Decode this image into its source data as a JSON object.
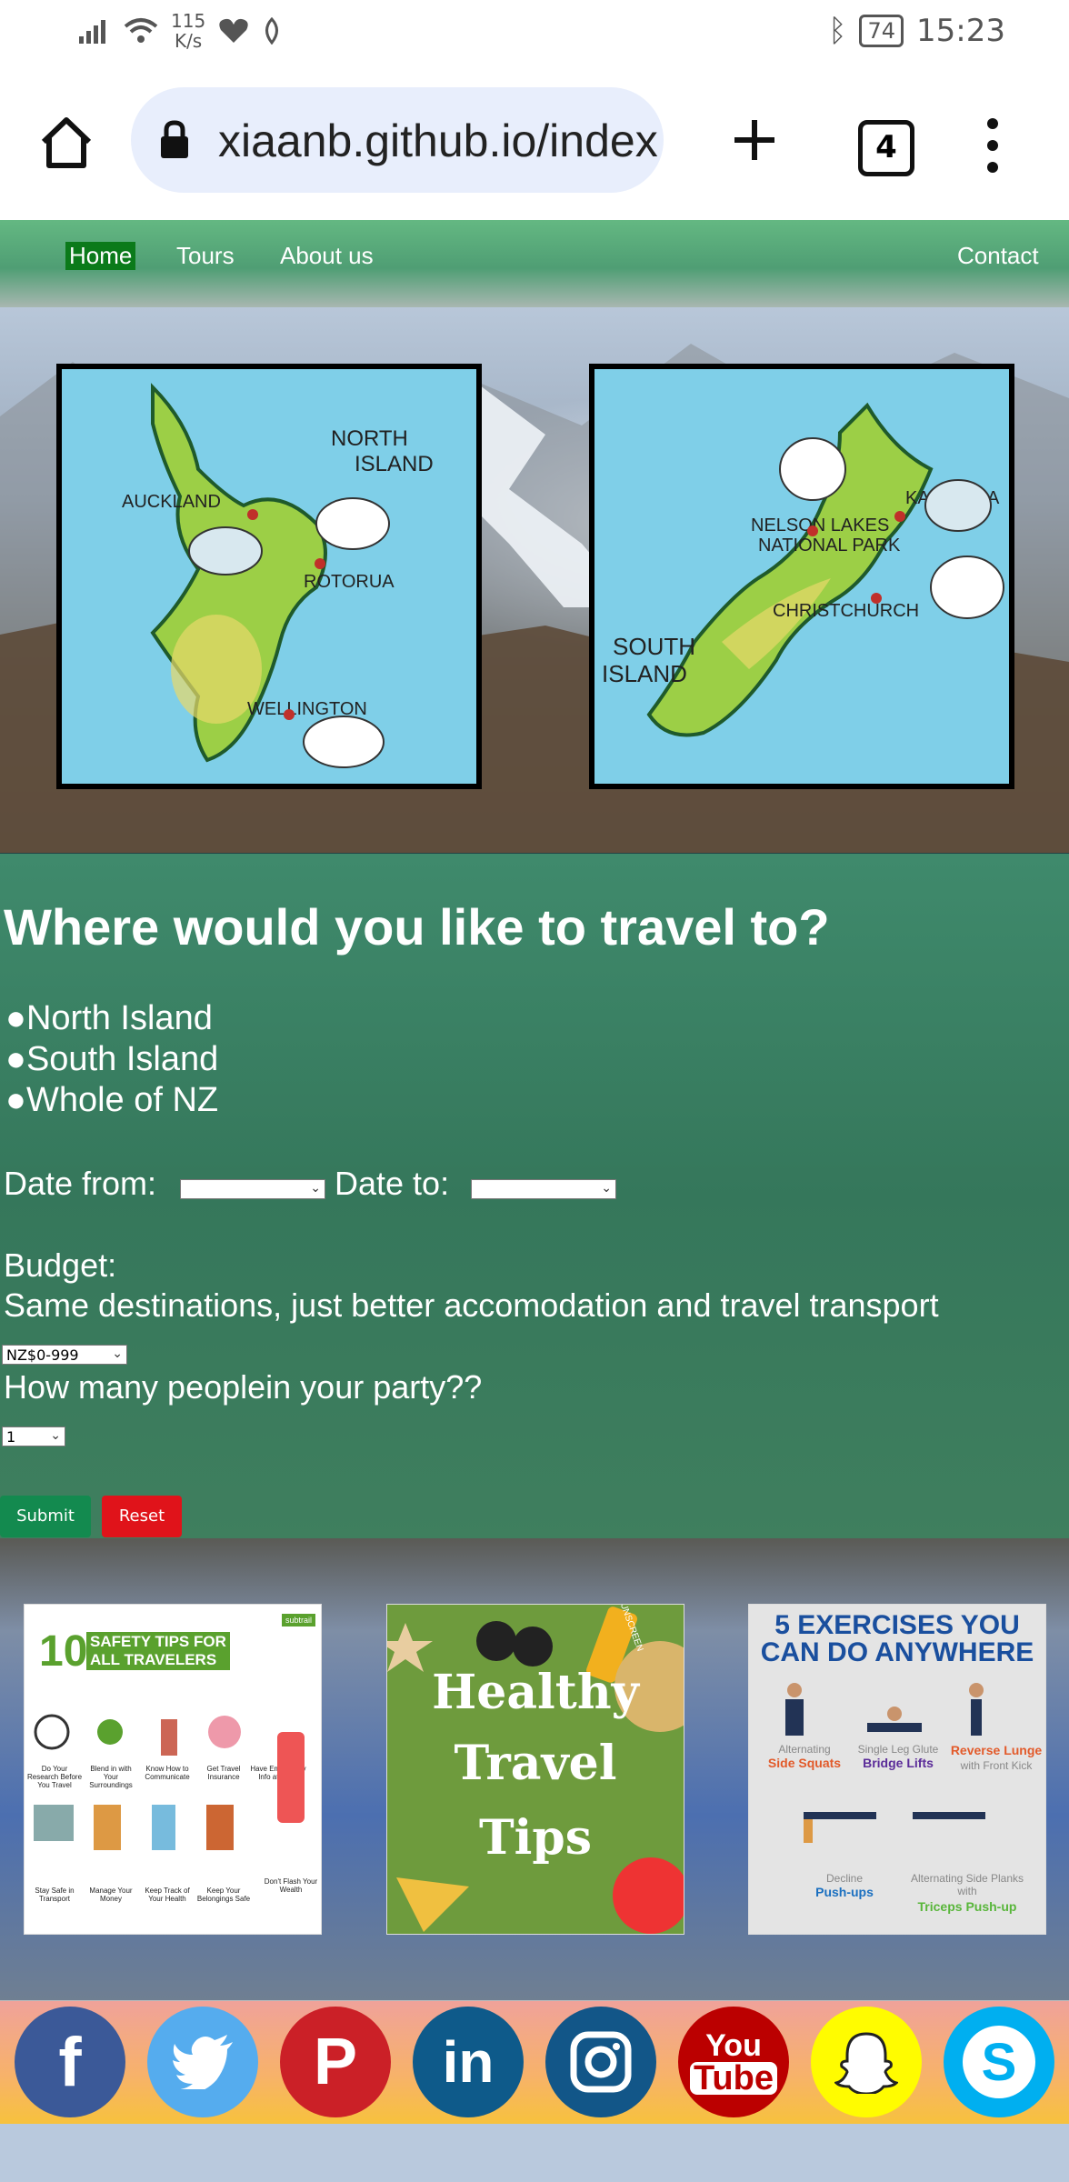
{
  "status_bar": {
    "net_speed_value": "115",
    "net_speed_unit": "K/s",
    "battery": "74",
    "time": "15:23"
  },
  "browser": {
    "url": "xiaanb.github.io/index",
    "tab_count": "4"
  },
  "nav": {
    "home": "Home",
    "tours": "Tours",
    "about": "About us",
    "contact": "Contact"
  },
  "maps": {
    "north": {
      "title_line1": "NORTH",
      "title_line2": "ISLAND",
      "places": [
        "AUCKLAND",
        "ROTORUA",
        "WELLINGTON"
      ]
    },
    "south": {
      "title_line1": "SOUTH",
      "title_line2": "ISLAND",
      "places": [
        "NELSON LAKES",
        "NATIONAL PARK",
        "KAIKOURA",
        "CHRISTCHURCH"
      ]
    }
  },
  "form": {
    "title": "Where would you like to travel to?",
    "options": [
      "●North Island",
      "●South Island",
      "●Whole of NZ"
    ],
    "date_from_label": "Date from:",
    "date_to_label": "Date to:",
    "budget_label": "Budget:",
    "budget_note": "Same destinations, just better accomodation and travel transport",
    "budget_value": "NZ$0-999",
    "party_label": "How many peoplein your party??",
    "party_value": "1",
    "submit": "Submit",
    "reset": "Reset"
  },
  "cards": {
    "safety": {
      "number": "10",
      "heading": "SAFETY TIPS FOR ALL TRAVELERS",
      "badge": "subtrail",
      "tips": [
        "Do Your Research Before You Travel",
        "Blend in with Your Surroundings",
        "Know How to Communicate",
        "Get Travel Insurance",
        "Have Emergency Info at Hand",
        "Stay Safe in Transport",
        "Manage Your Money",
        "Keep Track of Your Health",
        "Keep Your Belongings Safe",
        "Don't Flash Your Wealth"
      ]
    },
    "healthy": {
      "line1": "Healthy",
      "line2": "Travel",
      "line3": "Tips",
      "tag": "SUNSCREEN"
    },
    "exercise": {
      "heading_line1": "5 EXERCISES YOU",
      "heading_line2": "CAN DO ANYWHERE",
      "items": [
        {
          "pre": "Alternating",
          "name": "Side Squats",
          "post": ""
        },
        {
          "pre": "Single Leg Glute",
          "name": "Bridge Lifts",
          "post": ""
        },
        {
          "pre": "",
          "name": "Reverse Lunge",
          "post": "with Front Kick"
        },
        {
          "pre": "Decline",
          "name": "Push-ups",
          "post": ""
        },
        {
          "pre": "Alternating Side Planks with",
          "name": "Triceps Push-up",
          "post": ""
        }
      ]
    }
  },
  "social": {
    "icons": [
      {
        "name": "facebook",
        "glyph": "f",
        "color": "#3b5998"
      },
      {
        "name": "twitter",
        "glyph": "",
        "color": "#55acee"
      },
      {
        "name": "pinterest",
        "glyph": "P",
        "color": "#cb2027"
      },
      {
        "name": "linkedin",
        "glyph": "in",
        "color": "#0e5a8a"
      },
      {
        "name": "instagram",
        "glyph": "",
        "color": "#125688"
      },
      {
        "name": "youtube",
        "glyph_line1": "You",
        "glyph_line2": "Tube",
        "color": "#bb0000"
      },
      {
        "name": "snapchat",
        "glyph": "",
        "color": "#fffc00"
      },
      {
        "name": "skype",
        "glyph": "S",
        "color": "#00aff0"
      }
    ]
  }
}
